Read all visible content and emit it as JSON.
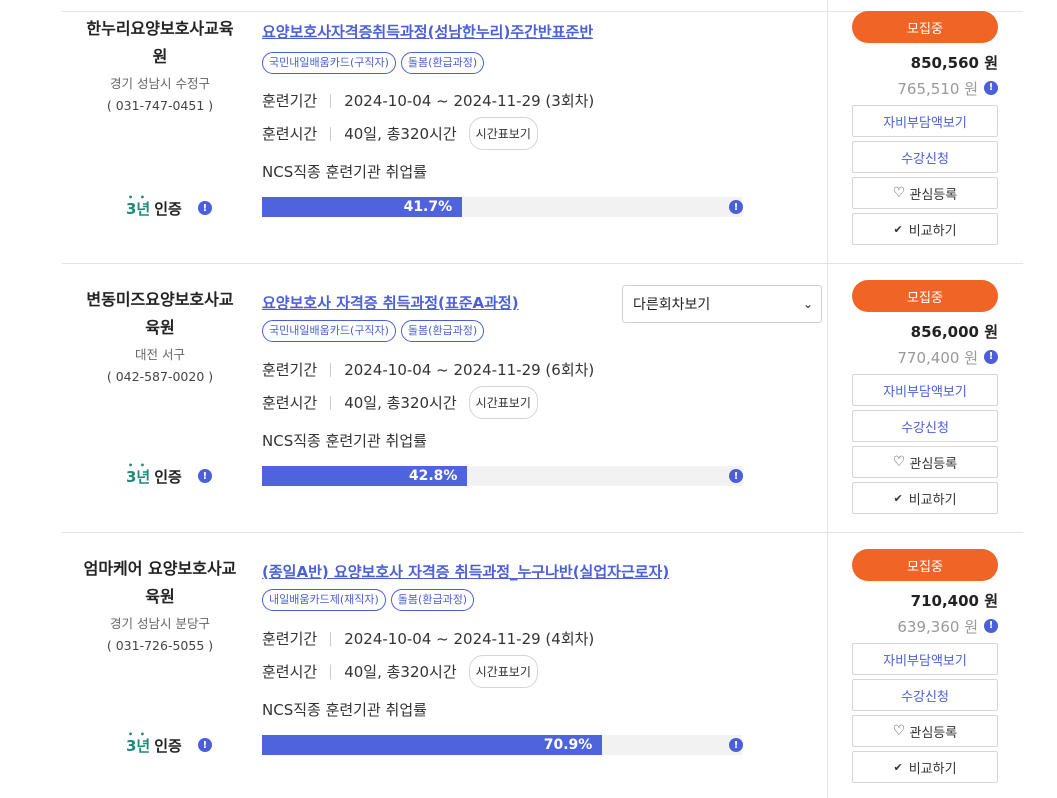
{
  "rows": [
    {
      "institution": {
        "name": "한누리요양보호사교육원",
        "location": "경기 성남시 수정구",
        "phone": "( 031-747-0451 )"
      },
      "certification": {
        "years": "3년",
        "label": "인증"
      },
      "course_title": "요양보호사자격증취득과정(성남한누리)주간반표준반",
      "tags": [
        "국민내일배움카드(구직자)",
        "돌봄(환급과정)"
      ],
      "period_label": "훈련기간",
      "period_value": "2024-10-04 ~ 2024-11-29 (3회차)",
      "hours_label": "훈련시간",
      "hours_value": "40일, 총320시간",
      "schedule_button": "시간표보기",
      "ncs_label": "NCS직종 훈련기관 취업률",
      "employment_rate": 41.7,
      "employment_rate_text": "41.7%",
      "status": "모집중",
      "price": "850,560 원",
      "sub_price": "765,510 원",
      "buttons": {
        "self_pay": "자비부담액보기",
        "apply": "수강신청",
        "interest": "관심등록",
        "compare": "비교하기"
      }
    },
    {
      "institution": {
        "name": "변동미즈요양보호사교육원",
        "location": "대전 서구",
        "phone": "( 042-587-0020 )"
      },
      "certification": {
        "years": "3년",
        "label": "인증"
      },
      "course_title": "요양보호사 자격증 취득과정(표준A과정)",
      "other_round_select": "다른회차보기",
      "tags": [
        "국민내일배움카드(구직자)",
        "돌봄(환급과정)"
      ],
      "period_label": "훈련기간",
      "period_value": "2024-10-04 ~ 2024-11-29 (6회차)",
      "hours_label": "훈련시간",
      "hours_value": "40일, 총320시간",
      "schedule_button": "시간표보기",
      "ncs_label": "NCS직종 훈련기관 취업률",
      "employment_rate": 42.8,
      "employment_rate_text": "42.8%",
      "status": "모집중",
      "price": "856,000 원",
      "sub_price": "770,400 원",
      "buttons": {
        "self_pay": "자비부담액보기",
        "apply": "수강신청",
        "interest": "관심등록",
        "compare": "비교하기"
      }
    },
    {
      "institution": {
        "name": "엄마케어 요양보호사교육원",
        "location": "경기 성남시 분당구",
        "phone": "( 031-726-5055 )"
      },
      "certification": {
        "years": "3년",
        "label": "인증"
      },
      "course_title": "(종일A반) 요양보호사 자격증 취득과정_누구나반(실업자근로자)",
      "tags": [
        "내일배움카드제(재직자)",
        "돌봄(환급과정)"
      ],
      "period_label": "훈련기간",
      "period_value": "2024-10-04 ~ 2024-11-29 (4회차)",
      "hours_label": "훈련시간",
      "hours_value": "40일, 총320시간",
      "schedule_button": "시간표보기",
      "ncs_label": "NCS직종 훈련기관 취업률",
      "employment_rate": 70.9,
      "employment_rate_text": "70.9%",
      "status": "모집중",
      "price": "710,400 원",
      "sub_price": "639,360 원",
      "buttons": {
        "self_pay": "자비부담액보기",
        "apply": "수강신청",
        "interest": "관심등록",
        "compare": "비교하기"
      }
    }
  ],
  "icons": {
    "info": "info-icon",
    "heart": "heart-icon",
    "check": "check-icon",
    "chevron": "chevron-down-icon"
  },
  "colors": {
    "accent": "#4a5fd8",
    "recruit": "#f06525",
    "bar": "#4f63dc",
    "cert": "#1e8a7a"
  }
}
